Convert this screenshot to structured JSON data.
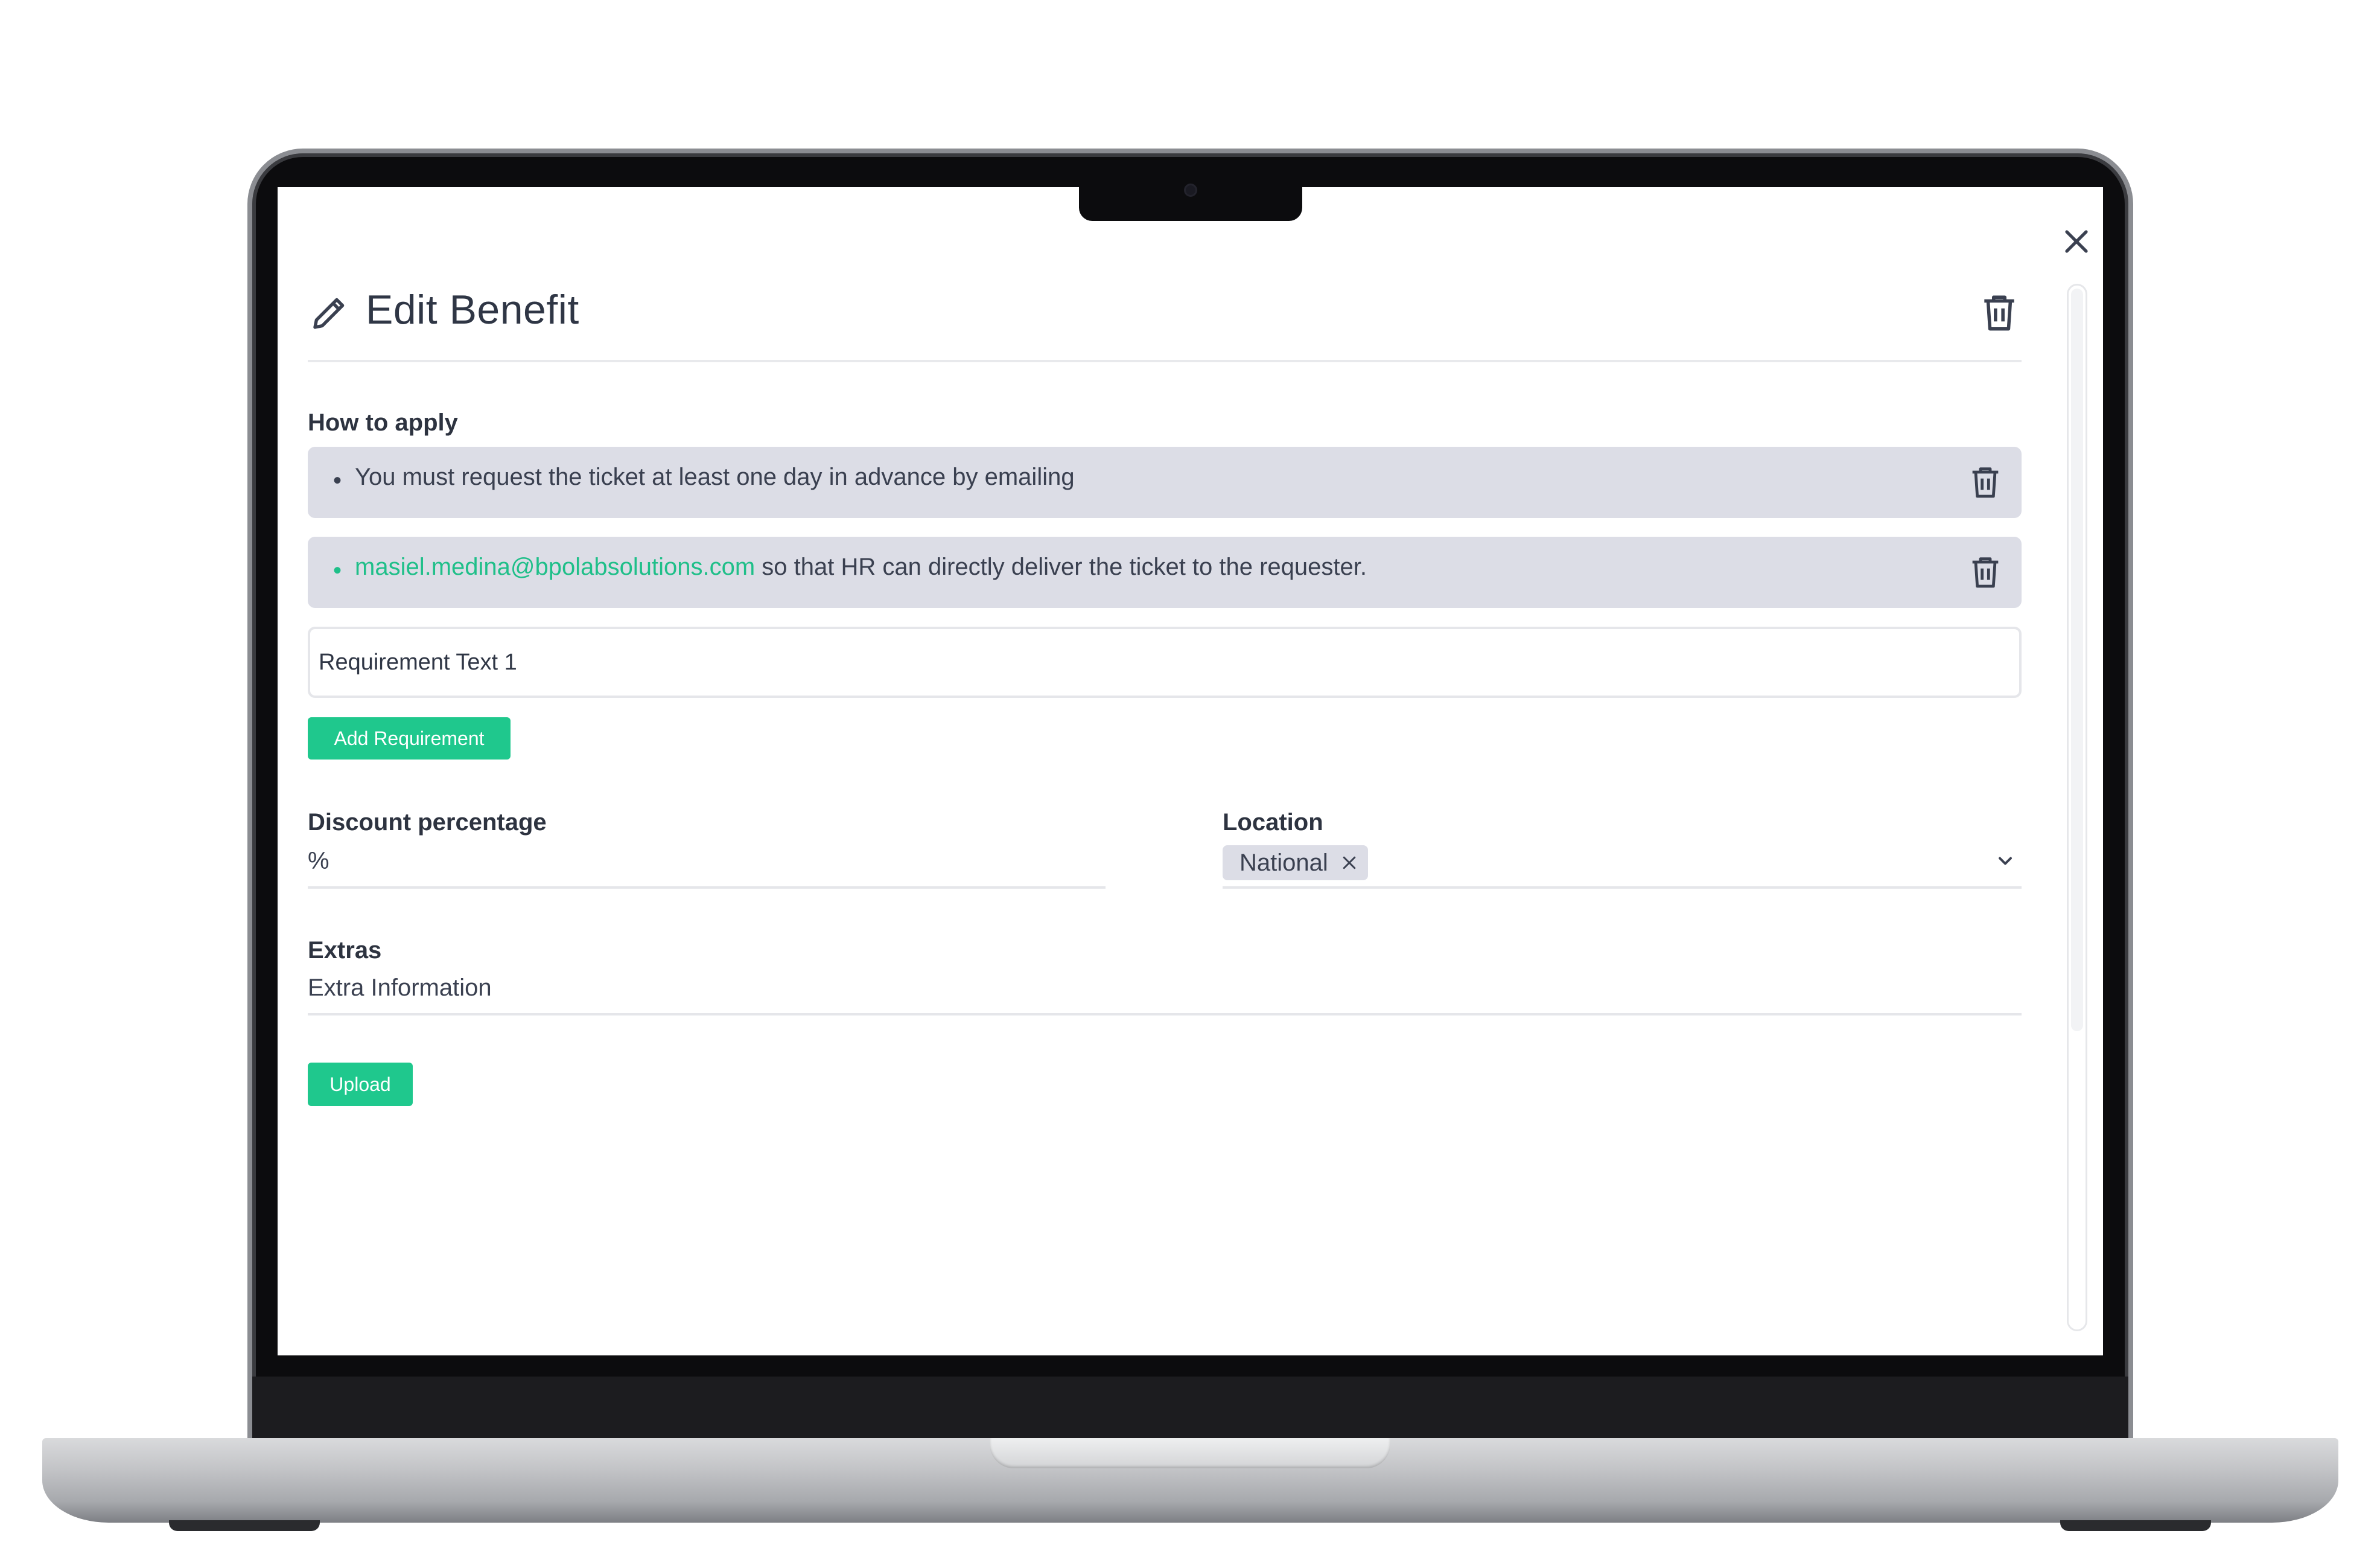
{
  "dialog": {
    "title": "Edit Benefit",
    "close_icon": "close-icon",
    "delete_icon": "trash-icon",
    "edit_icon": "pencil-icon"
  },
  "how_to_apply": {
    "label": "How to apply",
    "items": [
      {
        "bullet": "•",
        "text": "You must request the ticket at least one day in advance by emailing",
        "link": ""
      },
      {
        "bullet": "•",
        "link": "masiel.medina@bpolabsolutions.com",
        "text": " so that HR can directly deliver the ticket to the requester."
      }
    ],
    "input_value": "Requirement Text 1",
    "add_button": "Add Requirement"
  },
  "discount": {
    "label": "Discount percentage",
    "value": "%"
  },
  "location": {
    "label": "Location",
    "selected_chip": "National"
  },
  "extras": {
    "label": "Extras",
    "value": "Extra Information",
    "upload_button": "Upload"
  },
  "colors": {
    "accent": "#1fc88d",
    "chip_bg": "#dcdde6",
    "text": "#2d3340"
  }
}
